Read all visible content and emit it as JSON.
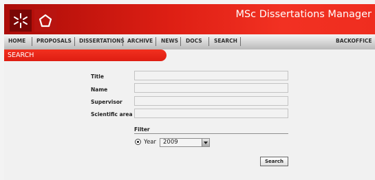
{
  "header": {
    "title": "MSc Dissertations Manager"
  },
  "nav": {
    "items": [
      "HOME",
      "PROPOSALS",
      "DISSERTATIONS",
      "ARCHIVE",
      "NEWS",
      "DOCS",
      "SEARCH"
    ],
    "backoffice": "BACKOFFICE"
  },
  "section": {
    "title": "SEARCH"
  },
  "form": {
    "fields": [
      {
        "label": "Title",
        "value": ""
      },
      {
        "label": "Name",
        "value": ""
      },
      {
        "label": "Supervisor",
        "value": ""
      },
      {
        "label": "Scientific area",
        "value": ""
      }
    ],
    "filter": {
      "title": "Filter",
      "option_label": "Year",
      "selected": true,
      "year_value": "2009"
    },
    "submit_label": "Search"
  },
  "icons": {
    "logo_left": "asterisk-logo-icon",
    "logo_right": "pentagon-logo-icon",
    "select_arrow": "chevron-down-icon"
  },
  "colors": {
    "brand_red": "#de1f14",
    "banner_dark": "#ab0c08",
    "nav_bg": "#d4d4d4"
  }
}
